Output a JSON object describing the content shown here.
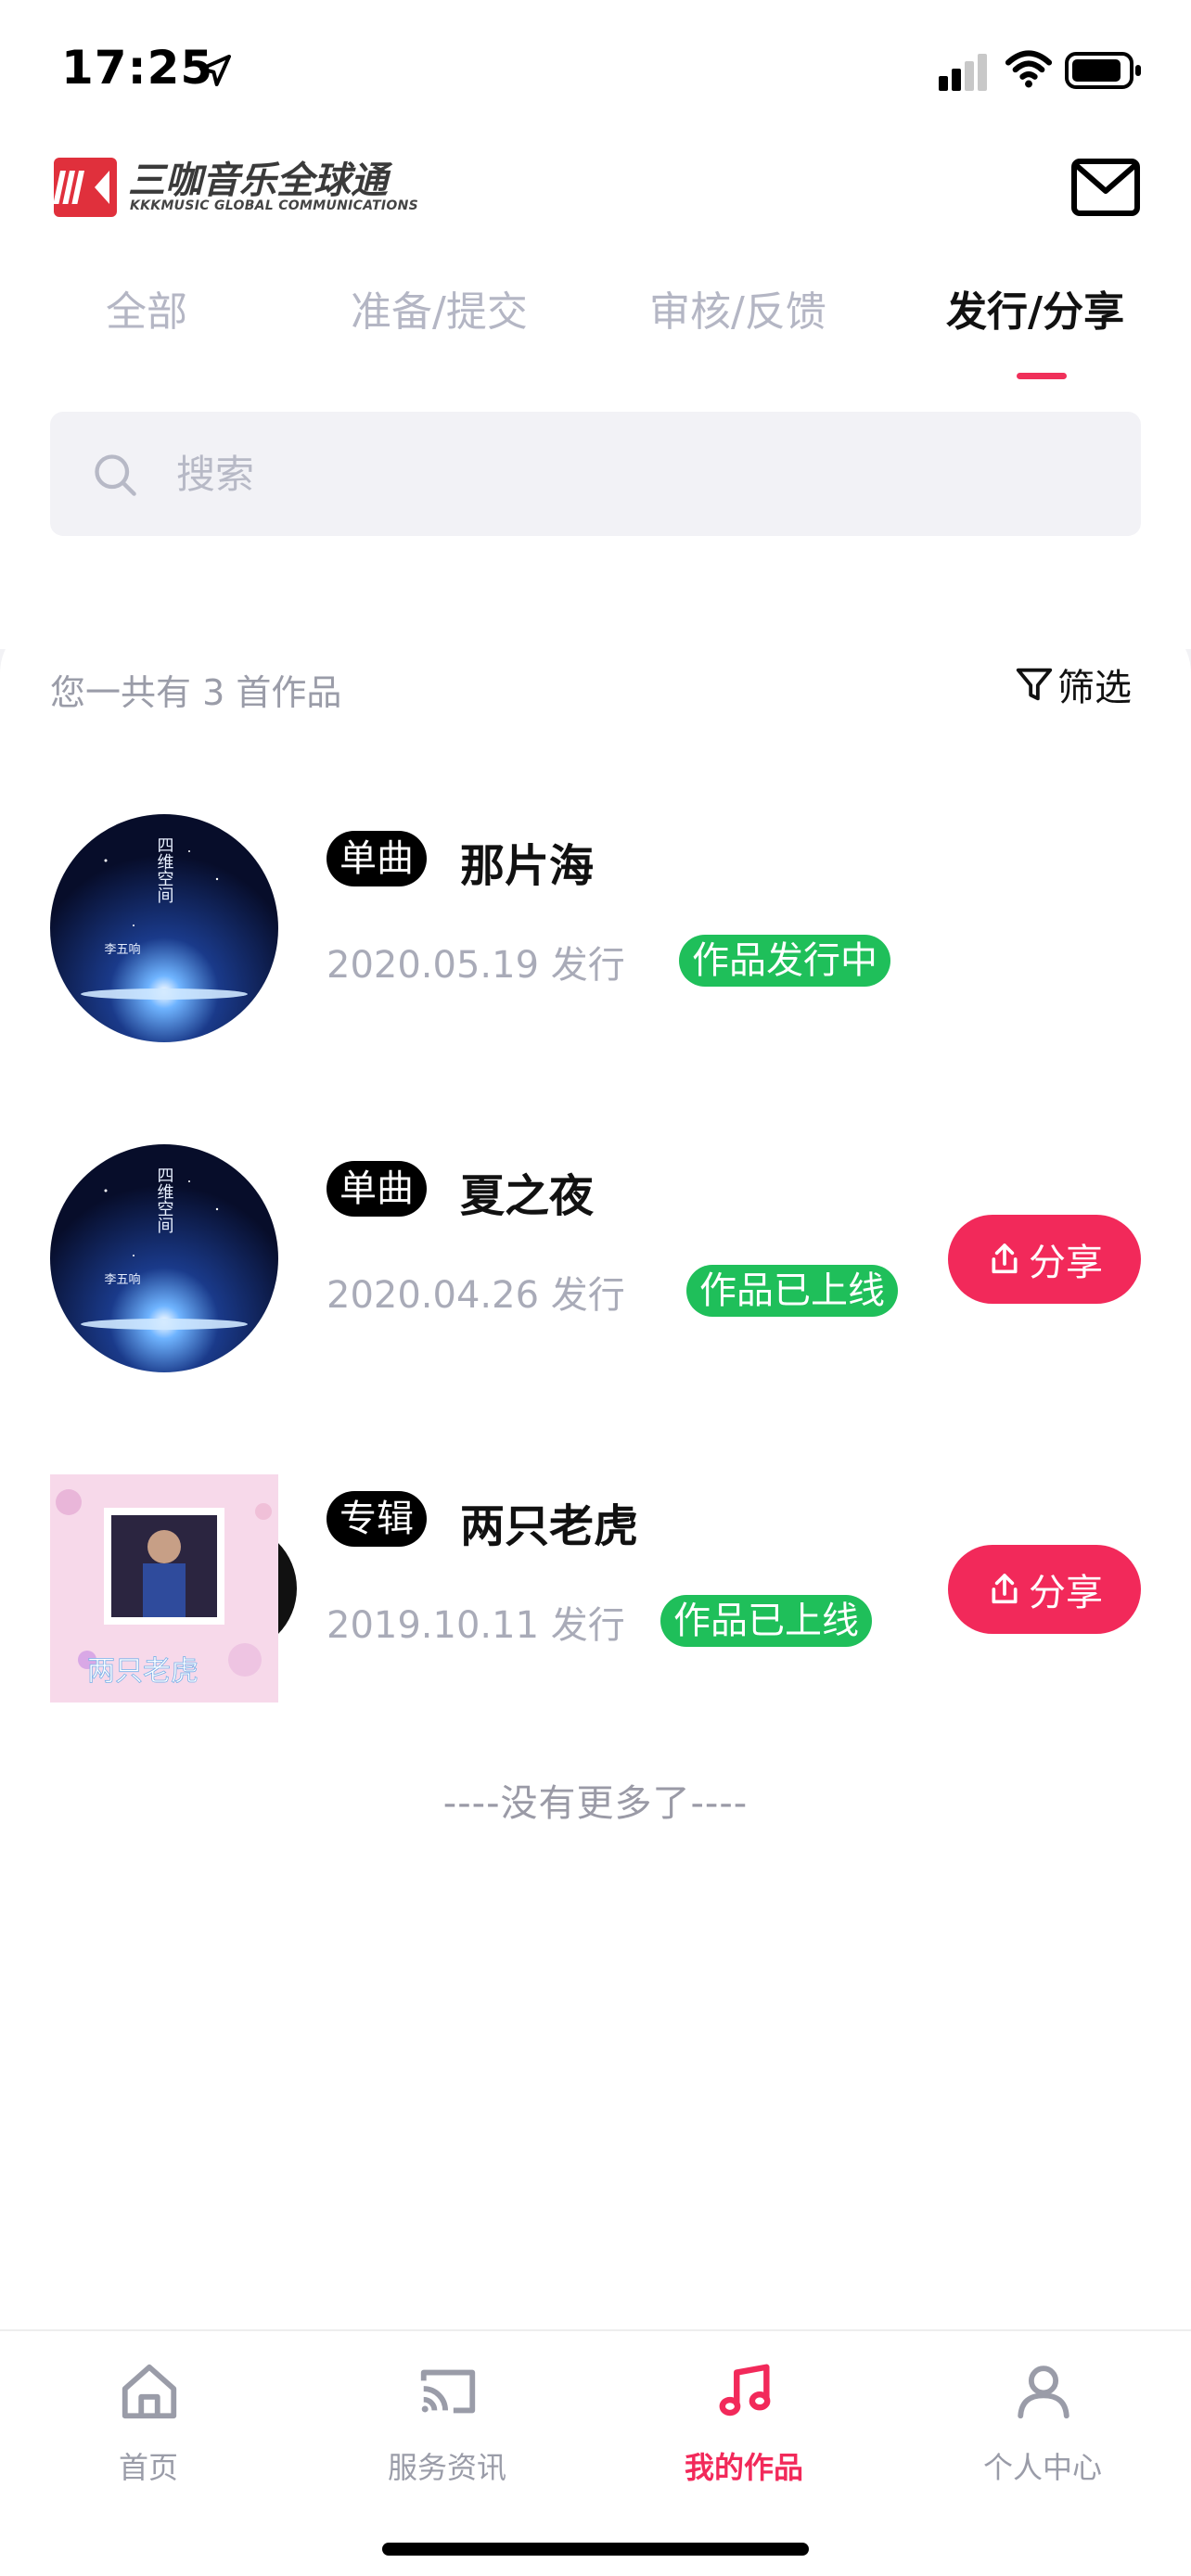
{
  "status_bar": {
    "time": "17:25",
    "icons": [
      "location-arrow-icon",
      "cellular-signal-icon",
      "wifi-icon",
      "battery-icon"
    ]
  },
  "header": {
    "logo_text": "三咖音乐全球通",
    "logo_subtitle": "KKKMUSIC GLOBAL COMMUNICATIONS",
    "mail_icon": "mail-icon"
  },
  "tabs": [
    {
      "label": "全部",
      "active": false
    },
    {
      "label": "准备/提交",
      "active": false
    },
    {
      "label": "审核/反馈",
      "active": false
    },
    {
      "label": "发行/分享",
      "active": true
    }
  ],
  "search": {
    "placeholder": "搜索",
    "value": ""
  },
  "list": {
    "summary": "您一共有 3 首作品",
    "filter_label": "筛选",
    "items": [
      {
        "type": "单曲",
        "title": "那片海",
        "release": "2020.05.19 发行",
        "status": "作品发行中",
        "share_label": null,
        "cover_title": "四维空间",
        "cover_artist": "李五响"
      },
      {
        "type": "单曲",
        "title": "夏之夜",
        "release": "2020.04.26 发行",
        "status": "作品已上线",
        "share_label": "分享",
        "cover_title": "四维空间",
        "cover_artist": "李五响"
      },
      {
        "type": "专辑",
        "title": "两只老虎",
        "release": "2019.10.11 发行",
        "status": "作品已上线",
        "share_label": "分享",
        "cover_title": "两只老虎"
      }
    ],
    "end_text": "----没有更多了----"
  },
  "bottom_nav": [
    {
      "label": "首页",
      "icon": "home-icon",
      "active": false
    },
    {
      "label": "服务资讯",
      "icon": "cast-icon",
      "active": false
    },
    {
      "label": "我的作品",
      "icon": "music-note-icon",
      "active": true
    },
    {
      "label": "个人中心",
      "icon": "user-icon",
      "active": false
    }
  ],
  "colors": {
    "accent": "#f2295a",
    "status_green": "#1fbf5a",
    "badge_black": "#000000",
    "muted_text": "#a9abb8"
  }
}
